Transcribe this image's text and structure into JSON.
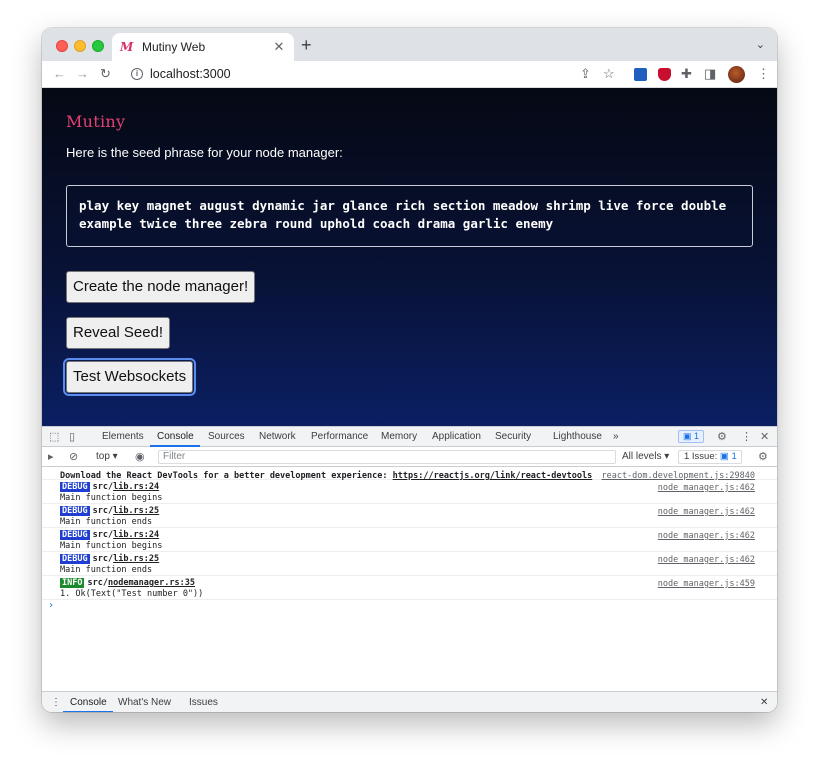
{
  "browser": {
    "tab_title": "Mutiny Web",
    "tab_favicon": "M",
    "url": "localhost:3000"
  },
  "page": {
    "logo": "Mutiny",
    "intro": "Here is the seed phrase for your node manager:",
    "seed_line1": "play key magnet august dynamic jar glance rich section meadow shrimp live force double",
    "seed_line2": "example twice three zebra round uphold coach drama garlic enemy",
    "buttons": {
      "create": "Create the node manager!",
      "reveal": "Reveal Seed!",
      "test": "Test Websockets"
    }
  },
  "devtools": {
    "tabs": [
      "Elements",
      "Console",
      "Sources",
      "Network",
      "Performance",
      "Memory",
      "Application",
      "Security",
      "Lighthouse"
    ],
    "more": "»",
    "issues_badge": "1",
    "context": "top",
    "filter_placeholder": "Filter",
    "levels": "All levels",
    "issues_pill": "1 Issue:",
    "issues_pill_count": "1",
    "messages": {
      "first_text": "Download the React DevTools for a better development experience: ",
      "first_link": "https://reactjs.org/link/react-devtools",
      "first_src": "react-dom.development.js:29840",
      "rows": [
        {
          "badge": "DEBUG",
          "file_prefix": "src/",
          "file": "lib.rs:24",
          "text": "Main function begins",
          "src": "node_manager.js:462"
        },
        {
          "badge": "DEBUG",
          "file_prefix": "src/",
          "file": "lib.rs:25",
          "text": "Main function ends",
          "src": "node_manager.js:462"
        },
        {
          "badge": "DEBUG",
          "file_prefix": "src/",
          "file": "lib.rs:24",
          "text": "Main function begins",
          "src": "node_manager.js:462"
        },
        {
          "badge": "DEBUG",
          "file_prefix": "src/",
          "file": "lib.rs:25",
          "text": "Main function ends",
          "src": "node_manager.js:462"
        },
        {
          "badge": "INFO",
          "file_prefix": "src/",
          "file": "nodemanager.rs:35",
          "text": "1. Ok(Text(\"Test number 0\"))",
          "src": "node_manager.js:459"
        }
      ]
    },
    "prompt": "›",
    "drawer_tabs": [
      "Console",
      "What's New",
      "Issues"
    ]
  },
  "colors": {
    "accent": "#1a73e8",
    "logo": "#e54072",
    "page_bg_top": "#050914",
    "page_bg_bottom": "#0b1f63",
    "debug_badge": "#1e3fcf",
    "info_badge": "#1b8a2c"
  }
}
